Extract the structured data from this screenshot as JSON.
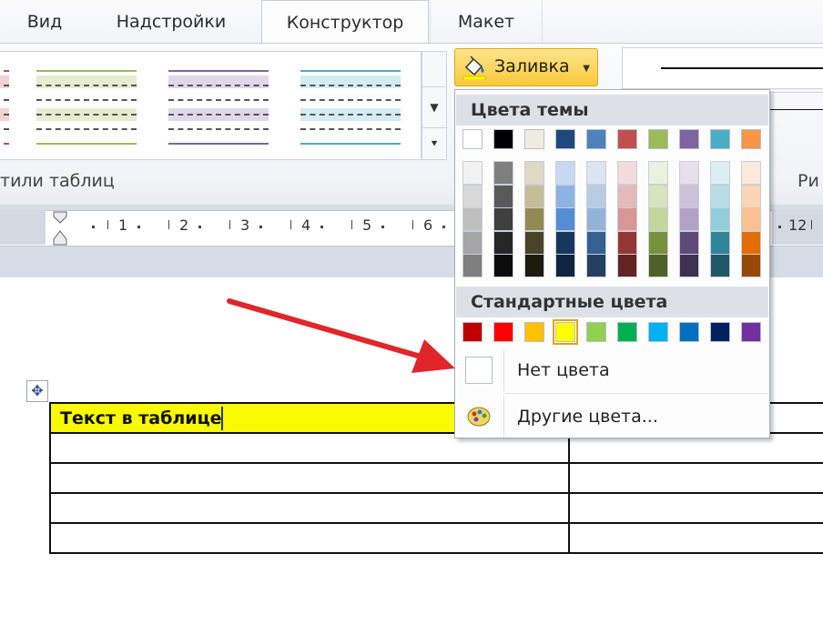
{
  "tabs": [
    {
      "label": "Вид",
      "active": false
    },
    {
      "label": "Надстройки",
      "active": false
    },
    {
      "label": "Конструктор",
      "active": true
    },
    {
      "label": "Макет",
      "active": false
    }
  ],
  "ribbon": {
    "group_table_styles": "тили таблиц",
    "group_right": "Ри",
    "fill_button": "Заливка"
  },
  "ruler": {
    "numbers": [
      "1",
      "2",
      "3",
      "4",
      "5",
      "6",
      "12"
    ]
  },
  "document": {
    "cell_text": "Текст в таблице"
  },
  "palette": {
    "theme_header": "Цвета темы",
    "standard_header": "Стандартные цвета",
    "no_color": "Нет цвета",
    "more_colors": "Другие цвета...",
    "theme_top": [
      "#ffffff",
      "#000000",
      "#eeece1",
      "#1f497d",
      "#4f81bd",
      "#c0504d",
      "#9bbb59",
      "#8064a2",
      "#4bacc6",
      "#f79646"
    ],
    "theme_shades": [
      [
        "#f2f2f2",
        "#d8d8d8",
        "#bfbfbf",
        "#a5a5a5",
        "#7f7f7f"
      ],
      [
        "#7f7f7f",
        "#595959",
        "#3f3f3f",
        "#262626",
        "#0c0c0c"
      ],
      [
        "#ddd9c3",
        "#c4bd97",
        "#938953",
        "#494429",
        "#1d1b10"
      ],
      [
        "#c6d9f0",
        "#8db3e2",
        "#548dd4",
        "#17365d",
        "#0f243e"
      ],
      [
        "#dbe5f1",
        "#b8cce4",
        "#95b3d7",
        "#366092",
        "#244061"
      ],
      [
        "#f2dcdb",
        "#e5b9b7",
        "#d99694",
        "#953734",
        "#632423"
      ],
      [
        "#ebf1dd",
        "#d7e3bc",
        "#c3d69b",
        "#76923c",
        "#4f6128"
      ],
      [
        "#e5e0ec",
        "#ccc1d9",
        "#b2a2c7",
        "#5f497a",
        "#3f3151"
      ],
      [
        "#dbeef3",
        "#b7dde8",
        "#92cddc",
        "#31859b",
        "#205867"
      ],
      [
        "#fdeada",
        "#fbd5b5",
        "#fac08f",
        "#e36c09",
        "#974806"
      ]
    ],
    "standard": [
      "#c00000",
      "#ff0000",
      "#ffc000",
      "#ffff00",
      "#92d050",
      "#00b050",
      "#00b0f0",
      "#0070c0",
      "#002060",
      "#7030a0"
    ],
    "selected_standard": "#ffff00"
  },
  "colors": {
    "accent_arrow": "#e0262b",
    "fill_button": "#f9c93a",
    "cell_highlight": "#f9f900"
  }
}
